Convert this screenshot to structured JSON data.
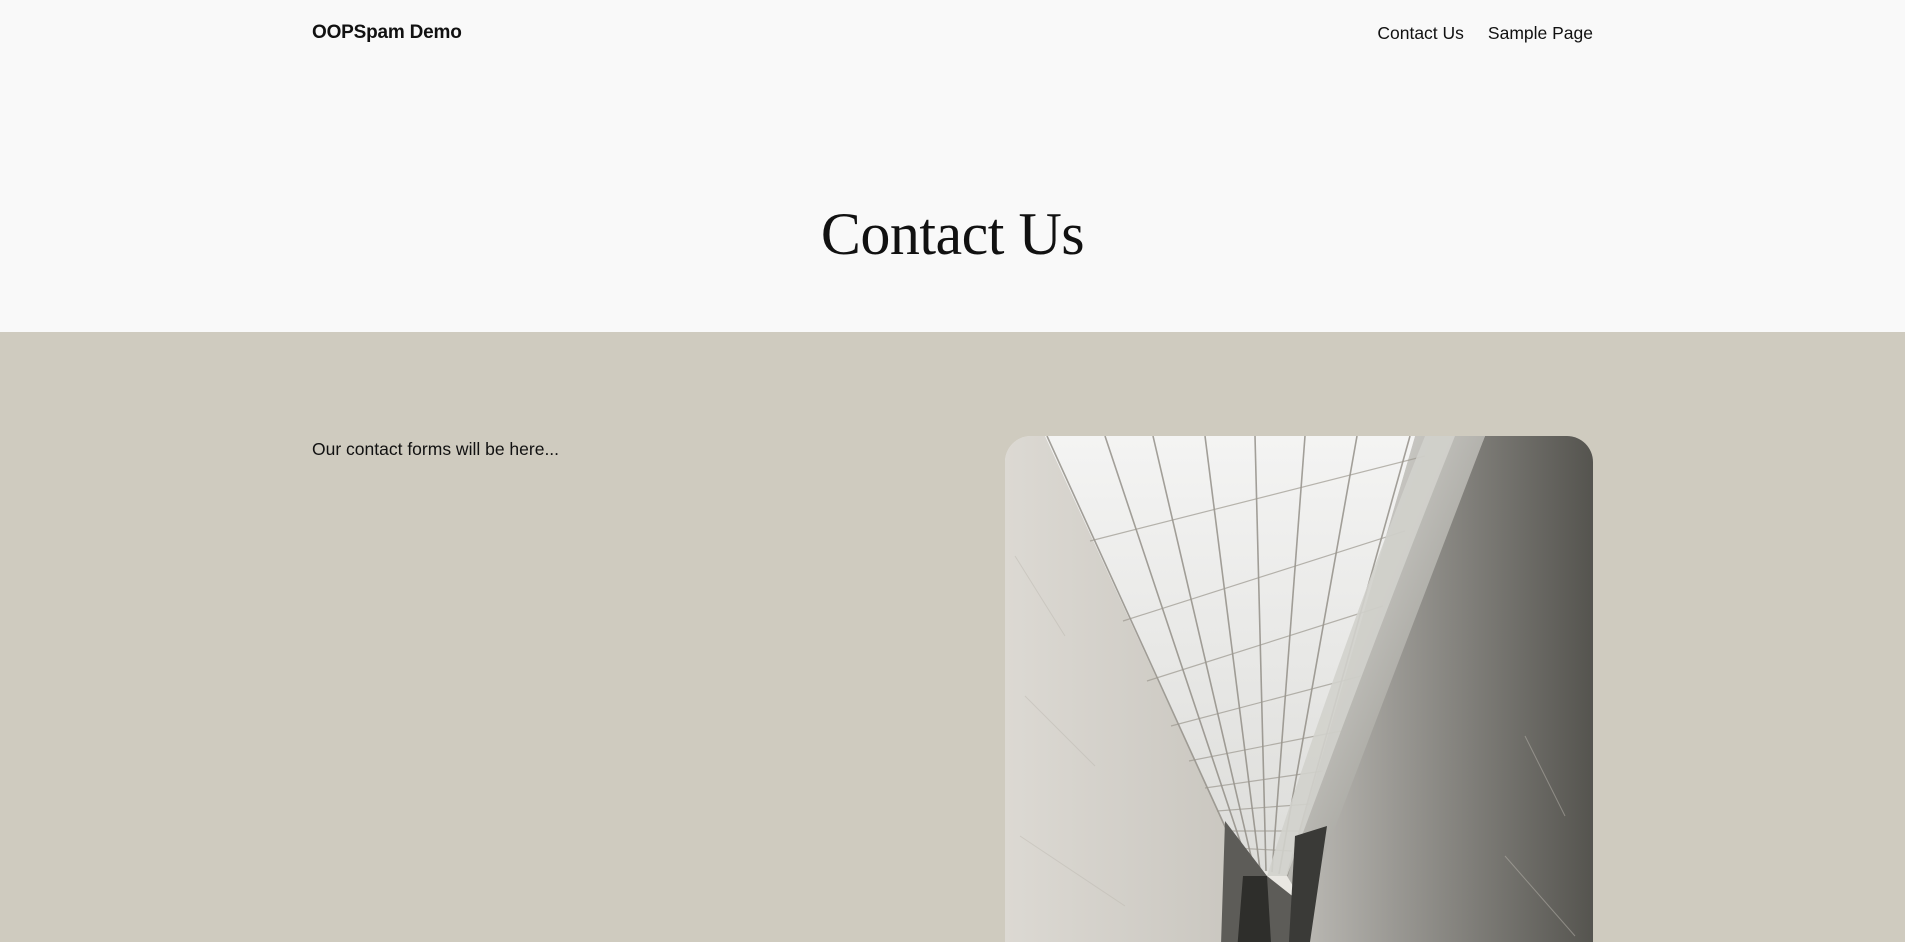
{
  "header": {
    "site_title": "OOPSpam Demo",
    "nav": [
      {
        "label": "Contact Us"
      },
      {
        "label": "Sample Page"
      }
    ]
  },
  "hero": {
    "title": "Contact Us"
  },
  "content": {
    "intro": "Our contact forms will be here..."
  },
  "image": {
    "icon": "architecture-skylight-photo"
  },
  "colors": {
    "page_bg": "#f9f9f9",
    "section_bg": "#cfcbbf",
    "text": "#111111"
  }
}
